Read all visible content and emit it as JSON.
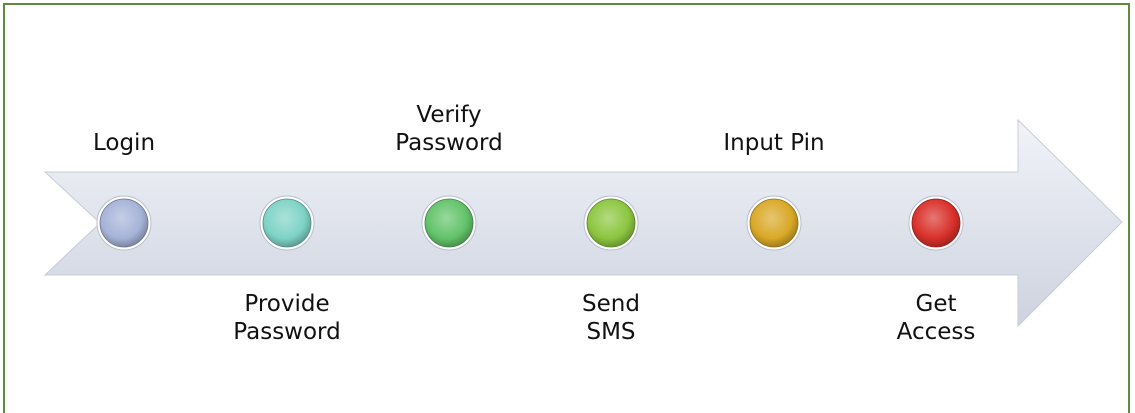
{
  "diagram": {
    "steps": [
      {
        "label": "Login",
        "color": "#a6b3d8",
        "position": "above"
      },
      {
        "label": "Provide\nPassword",
        "color": "#7ed3c6",
        "position": "below"
      },
      {
        "label": "Verify\nPassword",
        "color": "#62c36a",
        "position": "above"
      },
      {
        "label": "Send\nSMS",
        "color": "#8cc63f",
        "position": "below"
      },
      {
        "label": "Input Pin",
        "color": "#d9a826",
        "position": "above"
      },
      {
        "label": "Get\nAccess",
        "color": "#d9302a",
        "position": "below"
      }
    ]
  }
}
